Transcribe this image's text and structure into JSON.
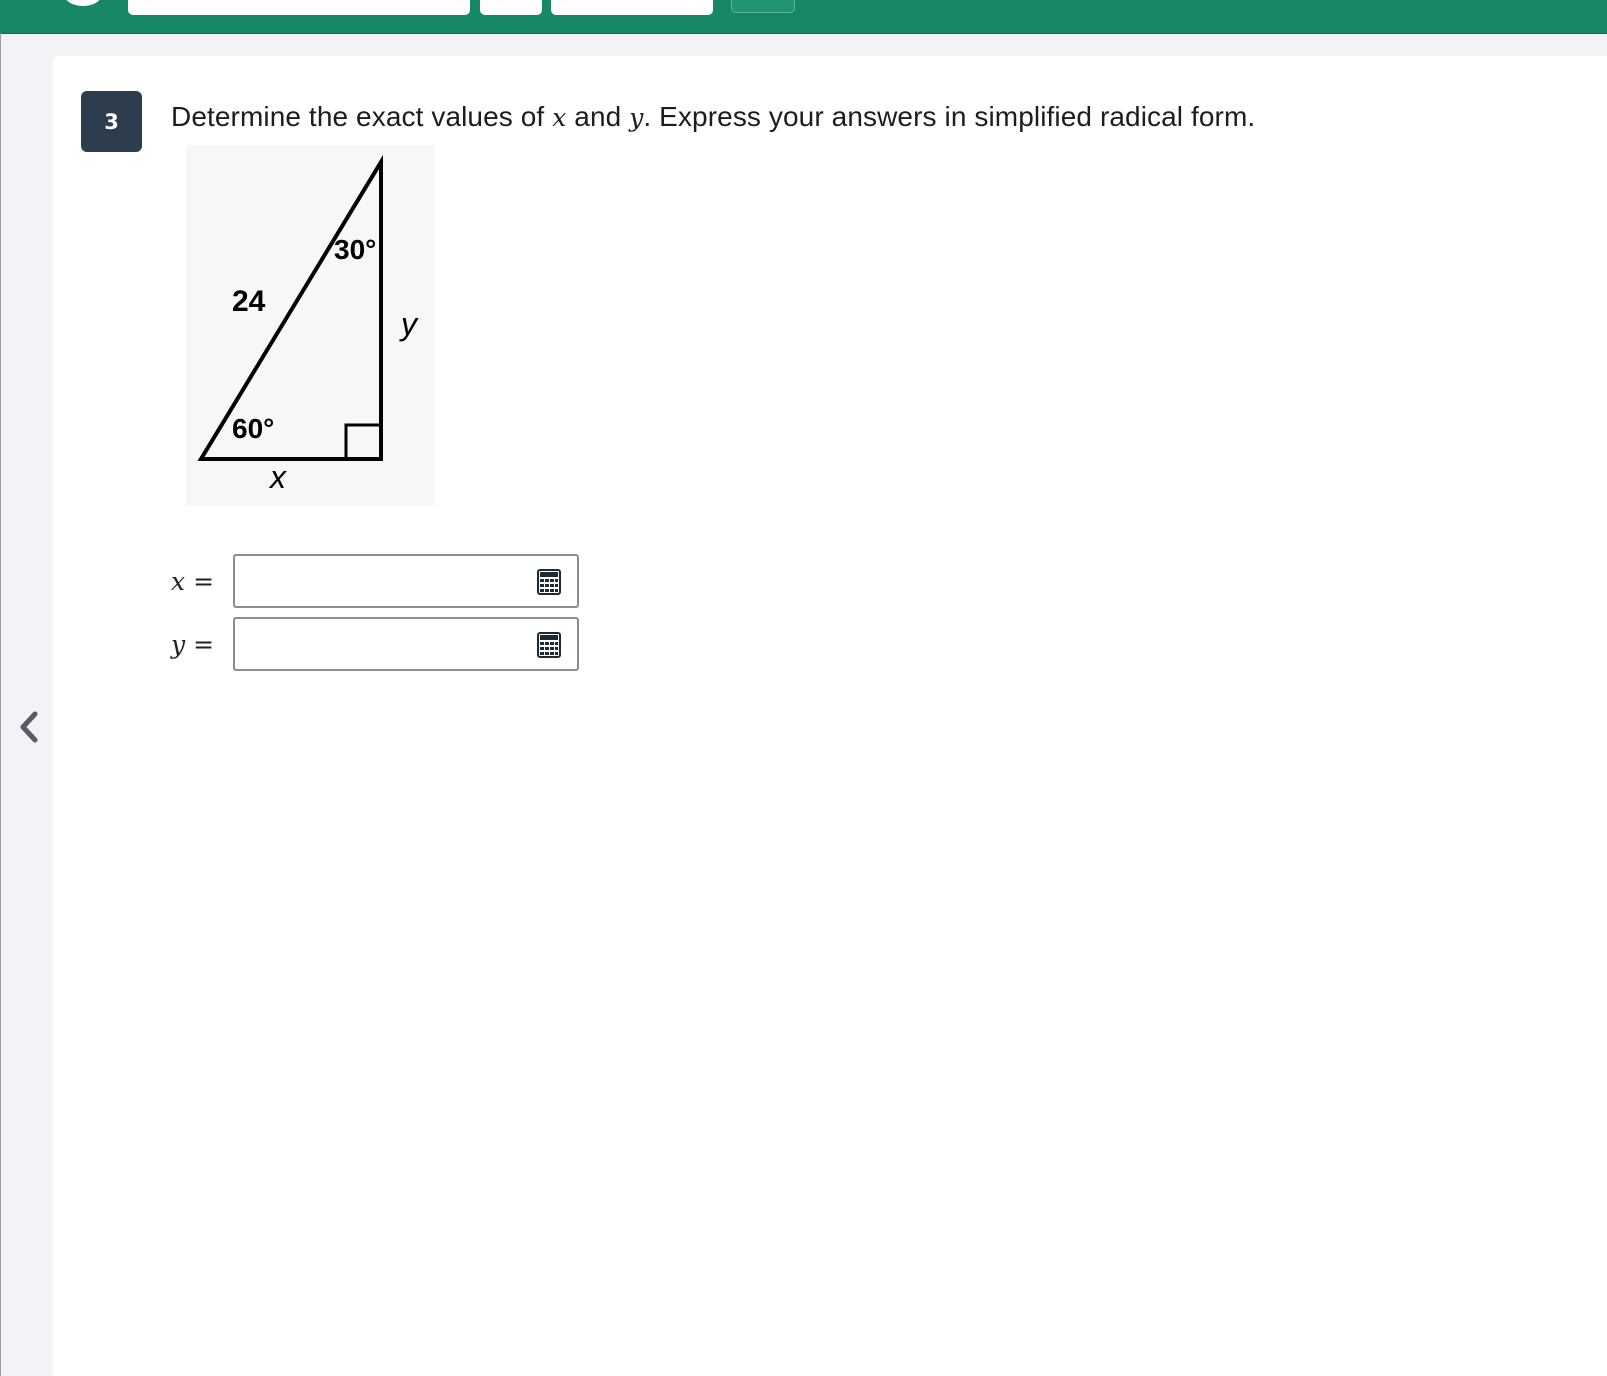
{
  "question": {
    "number": "3",
    "prompt_part1": "Determine the exact values of ",
    "var_x": "x",
    "prompt_part2": " and ",
    "var_y": "y",
    "prompt_part3": ". Express your answers in simplified radical form."
  },
  "diagram": {
    "hypotenuse_label": "24",
    "top_angle_label": "30°",
    "bottom_angle_label": "60°",
    "side_y_label": "y",
    "side_x_label": "x"
  },
  "answers": [
    {
      "var": "x",
      "eq": "=",
      "value": ""
    },
    {
      "var": "y",
      "eq": "=",
      "value": ""
    }
  ],
  "icons": {
    "calculator": "calculator-icon",
    "prev": "chevron-left-icon"
  },
  "colors": {
    "header": "#178765",
    "badge": "#2d3d4d",
    "background": "#f3f2f7"
  }
}
